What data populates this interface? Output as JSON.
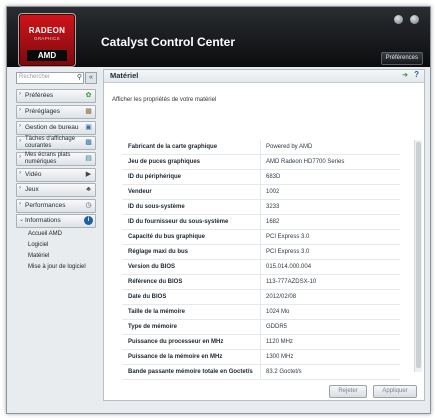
{
  "window": {
    "title": "Catalyst Control Center"
  },
  "logo": {
    "line1": "RADEON",
    "line2": "GRAPHICS",
    "brand": "AMD"
  },
  "header": {
    "preferences_label": "Préférences"
  },
  "sidebar": {
    "search_placeholder": "Rechercher",
    "collapse_label": "«",
    "items": [
      {
        "label": "Préférées",
        "icon": "star-icon"
      },
      {
        "label": "Préréglages",
        "icon": "preset-icon"
      },
      {
        "label": "Gestion de bureau",
        "icon": "desktop-icon"
      },
      {
        "label": "Tâches d'affichage courantes",
        "icon": "display-tasks-icon"
      },
      {
        "label": "Mes écrans plats numériques",
        "icon": "monitor-icon"
      },
      {
        "label": "Vidéo",
        "icon": "video-icon"
      },
      {
        "label": "Jeux",
        "icon": "gamepad-icon"
      },
      {
        "label": "Performances",
        "icon": "performance-icon"
      },
      {
        "label": "Informations",
        "icon": "info-icon"
      }
    ],
    "subitems": [
      "Accueil AMD",
      "Logiciel",
      "Matériel",
      "Mise à jour de logiciel"
    ]
  },
  "content": {
    "title": "Matériel",
    "description": "Afficher les propriétés de votre matériel",
    "properties": [
      {
        "label": "Fabricant de la carte graphique",
        "value": "Powered by AMD"
      },
      {
        "label": "Jeu de puces graphiques",
        "value": "AMD Radeon HD7700 Series"
      },
      {
        "label": "ID du périphérique",
        "value": "683D"
      },
      {
        "label": "Vendeur",
        "value": "1002"
      },
      {
        "label": "ID du sous-système",
        "value": "3233"
      },
      {
        "label": "ID du fournisseur du sous-système",
        "value": "1682"
      },
      {
        "label": "Capacité du bus graphique",
        "value": "PCI Express 3.0"
      },
      {
        "label": "Réglage maxi du bus",
        "value": "PCI Express 3.0"
      },
      {
        "label": "Version du BIOS",
        "value": "015.014.000.004"
      },
      {
        "label": "Référence du BIOS",
        "value": "113-777AZDSX-10"
      },
      {
        "label": "Date du BIOS",
        "value": "2012/02/08"
      },
      {
        "label": "Taille de la mémoire",
        "value": "1024 Mo"
      },
      {
        "label": "Type de mémoire",
        "value": "GDDR5"
      },
      {
        "label": "Puissance du processeur en MHz",
        "value": "1120 MHz"
      },
      {
        "label": "Puissance de la mémoire en MHz",
        "value": "1300 MHz"
      },
      {
        "label": "Bande passante mémoire totale en Goctet/s",
        "value": "83.2 Goctet/s"
      }
    ]
  },
  "footer": {
    "reset_label": "Rejeter",
    "apply_label": "Appliquer"
  }
}
